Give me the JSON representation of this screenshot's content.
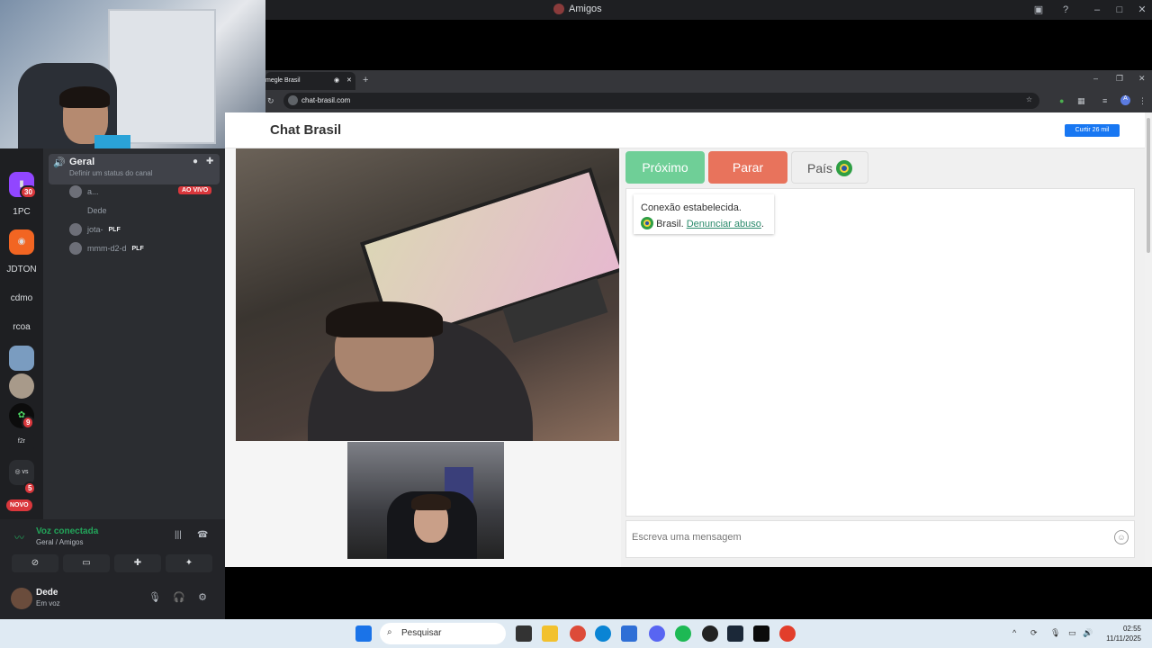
{
  "discord": {
    "window_title": "Amigos",
    "rail": {
      "items": [
        "1PC",
        "JDTON",
        "cdmo",
        "rcoa"
      ],
      "badges": {
        "twitch": "30",
        "server_a": "9",
        "server_b": "5"
      },
      "new_label": "NOVO"
    },
    "channel": {
      "name": "Geral",
      "status_placeholder": "Definir um status do canal",
      "live_badge": "AO VIVO",
      "members": [
        {
          "name": "a...",
          "tag": ""
        },
        {
          "name": "Dede",
          "tag": ""
        },
        {
          "name": "jota-",
          "tag": "PLF"
        },
        {
          "name": "mmm-d2-d",
          "tag": "PLF"
        }
      ]
    },
    "voice": {
      "title": "Voz conectada",
      "subtitle": "Geral / Amigos"
    },
    "user": {
      "name": "Dede",
      "status": "Em voz"
    }
  },
  "browser": {
    "tab_title": "megle Brasil",
    "url": "chat-brasil.com"
  },
  "page": {
    "brand": "Chat Brasil",
    "like_label": "Curtir 26 mil",
    "buttons": {
      "next": "Próximo",
      "stop": "Parar",
      "country": "País"
    },
    "message": {
      "line1": "Conexão estabelecida.",
      "country": "Brasil.",
      "report_link": "Denunciar abuso",
      "suffix": "."
    },
    "input_placeholder": "Escreva uma mensagem"
  },
  "taskbar": {
    "search_placeholder": "Pesquisar",
    "time": "02:55",
    "date": "11/11/2025"
  },
  "colors": {
    "next": "#6fcf97",
    "stop": "#e8735c",
    "voice_green": "#23a55a",
    "live_red": "#da373c"
  }
}
